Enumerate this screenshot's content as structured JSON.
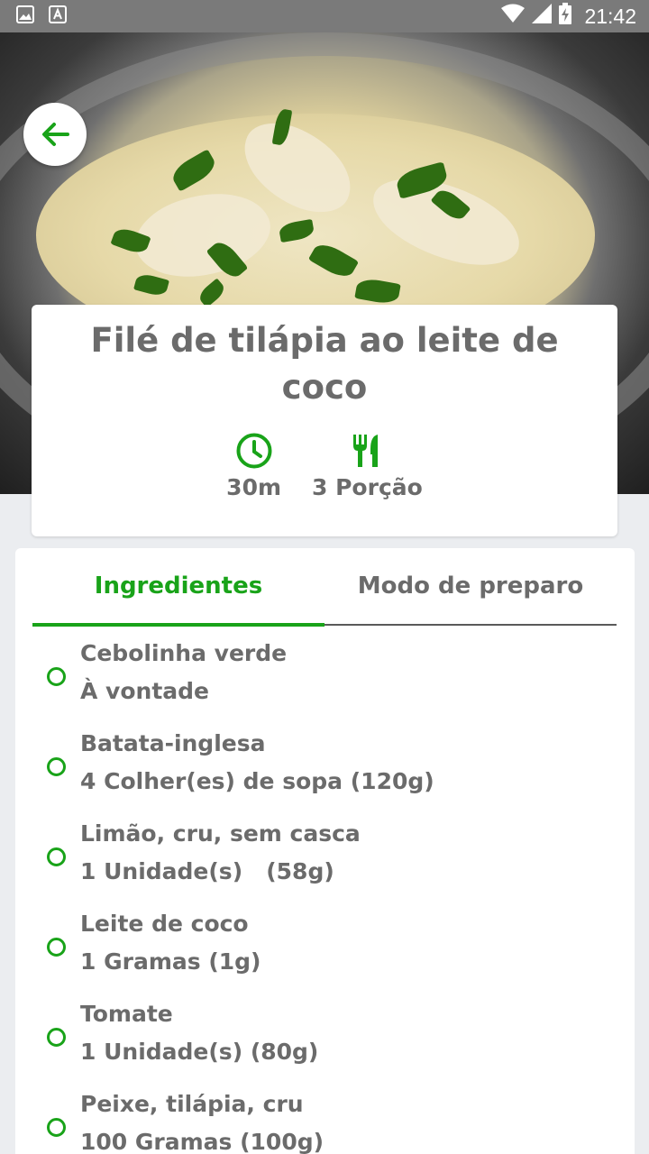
{
  "status_bar": {
    "time": "21:42",
    "icons": [
      "image-icon",
      "text-a-icon",
      "wifi-icon",
      "signal-icon",
      "battery-charging-icon"
    ],
    "bg_color": "#7a7a7a"
  },
  "recipe": {
    "title": "Filé de tilápia ao leite de coco",
    "time": "30m",
    "servings": "3 Porção",
    "time_icon": "clock-icon",
    "servings_icon": "fork-knife-icon"
  },
  "tabs": [
    {
      "label": "Ingredientes",
      "active": true
    },
    {
      "label": "Modo de preparo",
      "active": false
    }
  ],
  "ingredients": [
    {
      "name": "Cebolinha verde",
      "qty": "À vontade"
    },
    {
      "name": "Batata-inglesa",
      "qty": "4 Colher(es) de sopa (120g)"
    },
    {
      "name": "Limão, cru, sem casca",
      "qty": "1 Unidade(s)   (58g)"
    },
    {
      "name": "Leite de coco",
      "qty": "1 Gramas (1g)"
    },
    {
      "name": "Tomate",
      "qty": "1 Unidade(s) (80g)"
    },
    {
      "name": "Peixe, tilápia, cru",
      "qty": "100 Gramas (100g)"
    }
  ],
  "colors": {
    "accent": "#19a319",
    "text": "#6b6b6b",
    "background": "#ebedf0"
  }
}
